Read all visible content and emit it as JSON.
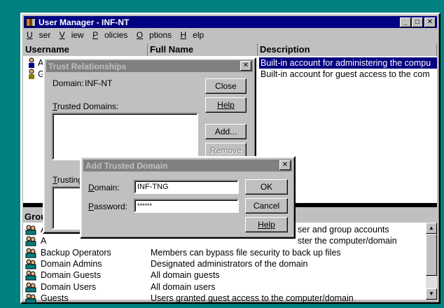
{
  "main_window": {
    "title": "User Manager - INF-NT",
    "menu": [
      "User",
      "View",
      "Policies",
      "Options",
      "Help"
    ],
    "columns": {
      "username": "Username",
      "full_name": "Full Name",
      "description": "Description"
    },
    "users": [
      {
        "username": "A",
        "full_name": "",
        "description": "Built-in account for administering the compu"
      },
      {
        "username": "G",
        "full_name": "",
        "description": "Built-in account for guest access to the com"
      }
    ],
    "groups_header": "Grou",
    "groups": [
      {
        "name": "A",
        "description": "ser and group accounts"
      },
      {
        "name": "A",
        "description": "ster the computer/domain"
      },
      {
        "name": "Backup Operators",
        "description": "Members can bypass file security to back up files"
      },
      {
        "name": "Domain Admins",
        "description": "Designated administrators of the domain"
      },
      {
        "name": "Domain Guests",
        "description": "All domain guests"
      },
      {
        "name": "Domain Users",
        "description": "All domain users"
      },
      {
        "name": "Guests",
        "description": "Users granted guest access to the computer/domain"
      }
    ]
  },
  "trust_dialog": {
    "title": "Trust Relationships",
    "domain_label": "Domain:",
    "domain_value": "INF-NT",
    "trusted_label": "Trusted Domains:",
    "trusting_label": "Trusting",
    "buttons": {
      "close": "Close",
      "help": "Help",
      "add": "Add...",
      "remove": "Remove"
    }
  },
  "add_dialog": {
    "title": "Add Trusted Domain",
    "domain_label": "Domain:",
    "domain_value": "INF-TNG",
    "password_label": "Password:",
    "password_value": "******",
    "buttons": {
      "ok": "OK",
      "cancel": "Cancel",
      "help": "Help"
    }
  }
}
